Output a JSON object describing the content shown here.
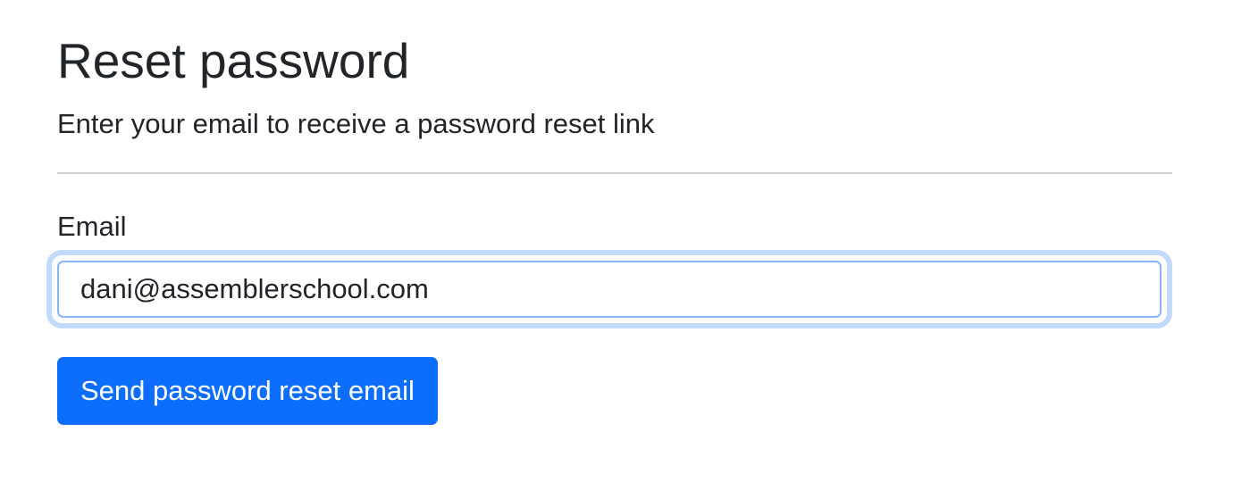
{
  "page": {
    "title": "Reset password",
    "subtitle": "Enter your email to receive a password reset link"
  },
  "form": {
    "email_label": "Email",
    "email_value": "dani@assemblerschool.com",
    "email_placeholder": "",
    "submit_label": "Send password reset email"
  },
  "colors": {
    "primary_button": "#0d6efd",
    "input_focus_border": "#86b7fe",
    "input_focus_ring": "#c2dafc",
    "text": "#212529",
    "divider": "#cfcfcf"
  }
}
